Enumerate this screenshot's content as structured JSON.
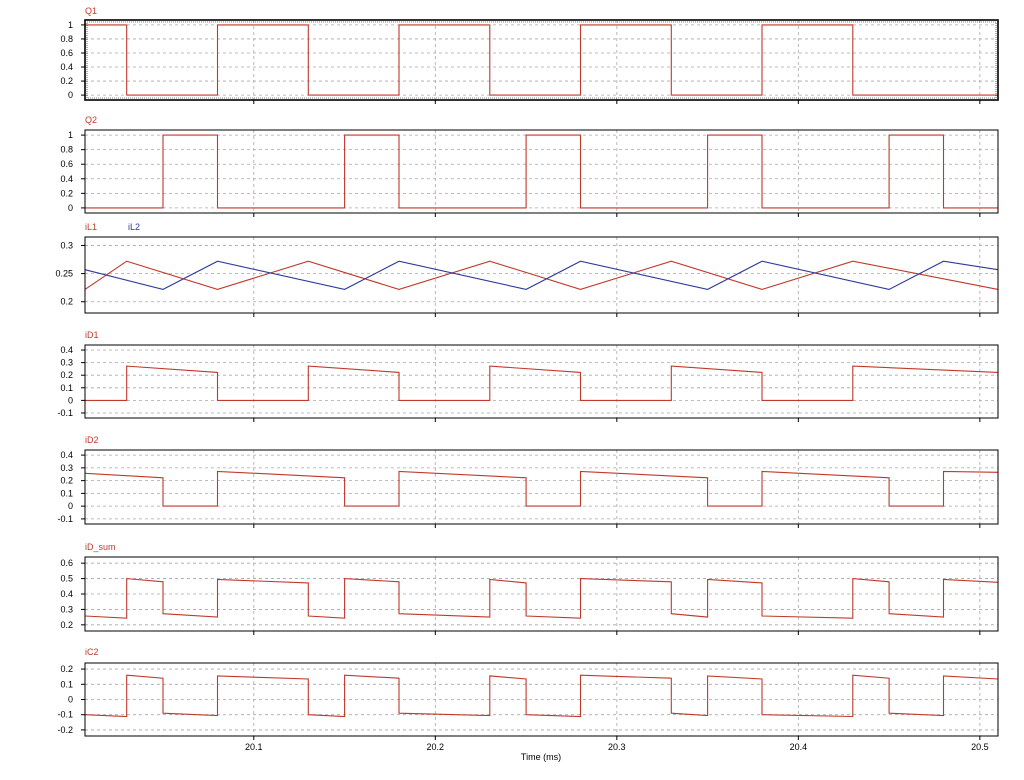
{
  "xlabel": "Time (ms)",
  "colors": {
    "red": "#c0392b",
    "blue": "#2e3a9a",
    "grid": "#a8a8a8",
    "frame": "#000000",
    "text": "#000000"
  },
  "chart_data": [
    {
      "type": "line",
      "title": "Q1",
      "ylim": [
        -0.07,
        1.07
      ],
      "yticks": [
        0,
        0.2,
        0.4,
        0.6,
        0.8,
        1
      ],
      "ytick_labels": [
        "0",
        "0.2",
        "0.4",
        "0.6",
        "0.8",
        "1"
      ],
      "xlim": [
        20.007,
        20.51
      ],
      "grid": true,
      "series": [
        {
          "name": "Q1",
          "color": "red",
          "x": [
            20.007,
            20.03,
            20.03,
            20.08,
            20.08,
            20.13,
            20.13,
            20.18,
            20.18,
            20.23,
            20.23,
            20.28,
            20.28,
            20.33,
            20.33,
            20.38,
            20.38,
            20.43,
            20.43,
            20.51
          ],
          "y": [
            1,
            1,
            0,
            0,
            1,
            1,
            0,
            0,
            1,
            1,
            0,
            0,
            1,
            1,
            0,
            0,
            1,
            1,
            0,
            0
          ]
        }
      ]
    },
    {
      "type": "line",
      "title": "Q2",
      "ylim": [
        -0.07,
        1.07
      ],
      "yticks": [
        0,
        0.2,
        0.4,
        0.6,
        0.8,
        1
      ],
      "ytick_labels": [
        "0",
        "0.2",
        "0.4",
        "0.6",
        "0.8",
        "1"
      ],
      "xlim": [
        20.007,
        20.51
      ],
      "grid": true,
      "series": [
        {
          "name": "Q2",
          "color": "red",
          "x": [
            20.007,
            20.05,
            20.05,
            20.08,
            20.08,
            20.15,
            20.15,
            20.18,
            20.18,
            20.25,
            20.25,
            20.28,
            20.28,
            20.35,
            20.35,
            20.38,
            20.38,
            20.45,
            20.45,
            20.48,
            20.48,
            20.51
          ],
          "y": [
            0,
            0,
            1,
            1,
            0,
            0,
            1,
            1,
            0,
            0,
            1,
            1,
            0,
            0,
            1,
            1,
            0,
            0,
            1,
            1,
            0,
            0
          ]
        }
      ]
    },
    {
      "type": "line",
      "title": "iL1",
      "ylim": [
        0.18,
        0.315
      ],
      "yticks": [
        0.2,
        0.25,
        0.3
      ],
      "ytick_labels": [
        "0.2",
        "0.25",
        "0.3"
      ],
      "xlim": [
        20.007,
        20.51
      ],
      "grid": true,
      "series": [
        {
          "name": "iL1",
          "color": "red",
          "x": [
            20.007,
            20.03,
            20.08,
            20.13,
            20.18,
            20.23,
            20.28,
            20.33,
            20.38,
            20.43,
            20.51
          ],
          "y": [
            0.222,
            0.272,
            0.222,
            0.272,
            0.222,
            0.272,
            0.222,
            0.272,
            0.222,
            0.272,
            0.222
          ]
        },
        {
          "name": "iL2",
          "color": "blue",
          "x": [
            20.007,
            20.05,
            20.08,
            20.15,
            20.18,
            20.25,
            20.28,
            20.35,
            20.38,
            20.45,
            20.48,
            20.51
          ],
          "y": [
            0.257,
            0.222,
            0.272,
            0.222,
            0.272,
            0.222,
            0.272,
            0.222,
            0.272,
            0.222,
            0.272,
            0.257
          ]
        }
      ]
    },
    {
      "type": "line",
      "title": "iD1",
      "ylim": [
        -0.14,
        0.44
      ],
      "yticks": [
        -0.1,
        0,
        0.1,
        0.2,
        0.3,
        0.4
      ],
      "ytick_labels": [
        "-0.1",
        "0",
        "0.1",
        "0.2",
        "0.3",
        "0.4"
      ],
      "xlim": [
        20.007,
        20.51
      ],
      "grid": true,
      "series": [
        {
          "name": "iD1",
          "color": "red",
          "x": [
            20.007,
            20.03,
            20.03,
            20.08,
            20.08,
            20.13,
            20.13,
            20.18,
            20.18,
            20.23,
            20.23,
            20.28,
            20.28,
            20.33,
            20.33,
            20.38,
            20.38,
            20.43,
            20.43,
            20.51
          ],
          "y": [
            0,
            0,
            0.272,
            0.222,
            0,
            0,
            0.272,
            0.222,
            0,
            0,
            0.272,
            0.222,
            0,
            0,
            0.272,
            0.222,
            0,
            0,
            0.272,
            0.222
          ]
        }
      ]
    },
    {
      "type": "line",
      "title": "iD2",
      "ylim": [
        -0.14,
        0.44
      ],
      "yticks": [
        -0.1,
        0,
        0.1,
        0.2,
        0.3,
        0.4
      ],
      "ytick_labels": [
        "-0.1",
        "0",
        "0.1",
        "0.2",
        "0.3",
        "0.4"
      ],
      "xlim": [
        20.007,
        20.51
      ],
      "grid": true,
      "series": [
        {
          "name": "iD2",
          "color": "red",
          "x": [
            20.007,
            20.05,
            20.05,
            20.08,
            20.08,
            20.15,
            20.15,
            20.18,
            20.18,
            20.25,
            20.25,
            20.28,
            20.28,
            20.35,
            20.35,
            20.38,
            20.38,
            20.45,
            20.45,
            20.48,
            20.48,
            20.51
          ],
          "y": [
            0.257,
            0.222,
            0,
            0,
            0.272,
            0.222,
            0,
            0,
            0.272,
            0.222,
            0,
            0,
            0.272,
            0.222,
            0,
            0,
            0.272,
            0.222,
            0,
            0,
            0.272,
            0.265
          ]
        }
      ]
    },
    {
      "type": "line",
      "title": "iD_sum",
      "ylim": [
        0.16,
        0.64
      ],
      "yticks": [
        0.2,
        0.3,
        0.4,
        0.5,
        0.6
      ],
      "ytick_labels": [
        "0.2",
        "0.3",
        "0.4",
        "0.5",
        "0.6"
      ],
      "xlim": [
        20.007,
        20.51
      ],
      "grid": true,
      "series": [
        {
          "name": "iD_sum",
          "color": "red",
          "x": [
            20.007,
            20.03,
            20.03,
            20.05,
            20.05,
            20.08,
            20.08,
            20.13,
            20.13,
            20.15,
            20.15,
            20.18,
            20.18,
            20.23,
            20.23,
            20.25,
            20.25,
            20.28,
            20.28,
            20.33,
            20.33,
            20.35,
            20.35,
            20.38,
            20.38,
            20.43,
            20.43,
            20.45,
            20.45,
            20.48,
            20.48,
            20.51
          ],
          "y": [
            0.257,
            0.243,
            0.5,
            0.479,
            0.272,
            0.25,
            0.494,
            0.472,
            0.257,
            0.243,
            0.5,
            0.479,
            0.272,
            0.25,
            0.494,
            0.472,
            0.257,
            0.243,
            0.5,
            0.479,
            0.272,
            0.25,
            0.494,
            0.472,
            0.257,
            0.243,
            0.5,
            0.479,
            0.272,
            0.25,
            0.494,
            0.476
          ]
        }
      ]
    },
    {
      "type": "line",
      "title": "iC2",
      "ylim": [
        -0.24,
        0.24
      ],
      "yticks": [
        -0.2,
        -0.1,
        0,
        0.1,
        0.2
      ],
      "ytick_labels": [
        "-0.2",
        "-0.1",
        "0",
        "0.1",
        "0.2"
      ],
      "xlim": [
        20.007,
        20.51
      ],
      "grid": true,
      "series": [
        {
          "name": "iC2",
          "color": "red",
          "x": [
            20.007,
            20.03,
            20.03,
            20.05,
            20.05,
            20.08,
            20.08,
            20.13,
            20.13,
            20.15,
            20.15,
            20.18,
            20.18,
            20.23,
            20.23,
            20.25,
            20.25,
            20.28,
            20.28,
            20.33,
            20.33,
            20.35,
            20.35,
            20.38,
            20.38,
            20.43,
            20.43,
            20.45,
            20.45,
            20.48,
            20.48,
            20.51
          ],
          "y": [
            -0.1,
            -0.112,
            0.16,
            0.14,
            -0.09,
            -0.105,
            0.155,
            0.135,
            -0.1,
            -0.112,
            0.16,
            0.14,
            -0.09,
            -0.105,
            0.155,
            0.135,
            -0.1,
            -0.112,
            0.16,
            0.14,
            -0.09,
            -0.105,
            0.155,
            0.135,
            -0.1,
            -0.112,
            0.16,
            0.14,
            -0.09,
            -0.105,
            0.155,
            0.135
          ]
        }
      ]
    }
  ],
  "xticks": [
    20.1,
    20.2,
    20.3,
    20.4,
    20.5
  ],
  "xtick_labels": [
    "20.1",
    "20.2",
    "20.3",
    "20.4",
    "20.5"
  ]
}
